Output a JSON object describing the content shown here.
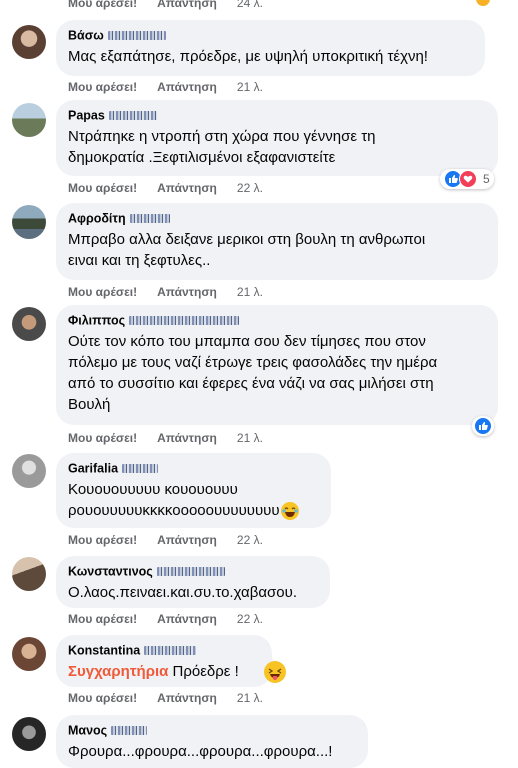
{
  "top_actions": {
    "like": "Μου αρέσει!",
    "reply": "Απάντηση",
    "time": "24 λ."
  },
  "comments": [
    {
      "name": "Βάσω",
      "text": [
        "Μας εξαπάτησε, πρόεδρε, με υψηλή υποκριτική τέχνη!"
      ],
      "like": "Μου αρέσει!",
      "reply": "Απάντηση",
      "time": "21 λ."
    },
    {
      "name": "Papas",
      "text": [
        "Ντράπηκε η ντροπή στη χώρα που γέννησε τη",
        "δημοκρατία .Ξεφτιλισμένοι εξαφανιστείτε"
      ],
      "like": "Μου αρέσει!",
      "reply": "Απάντηση",
      "time": "22 λ.",
      "reaction_count": "5"
    },
    {
      "name": "Αφροδίτη",
      "text": [
        "Μπραβο αλλα δειξανε μερικοι στη βουλη τη ανθρωποι",
        "ειναι και τη ξεφτυλες.."
      ],
      "like": "Μου αρέσει!",
      "reply": "Απάντηση",
      "time": "21 λ."
    },
    {
      "name": "Φιλιππος",
      "text": [
        "Ούτε τον κόπο του μπαμπα σου δεν τίμησες που στον",
        "πόλεμο με τους ναζί έτρωγε τρεις φασολάδες την ημέρα",
        "από το συσσίτιο και έφερες ένα νάζι να σας μιλήσει στη",
        "Βουλή"
      ],
      "like": "Μου αρέσει!",
      "reply": "Απάντηση",
      "time": "21 λ."
    },
    {
      "name": "Garifalia",
      "text": [
        "Κουουουυυυυ κουουουυυ",
        "ρουουυυυυκκκκοοοοουυυυυυυυ"
      ],
      "like": "Μου αρέσει!",
      "reply": "Απάντηση",
      "time": "22 λ."
    },
    {
      "name": "Κωνσταντινος",
      "text": [
        "Ο.λαος.πειναει.και.συ.το.χαβασου."
      ],
      "like": "Μου αρέσει!",
      "reply": "Απάντηση",
      "time": "22 λ."
    },
    {
      "name": "Konstantina",
      "text_accent": "Συγχαρητήρια",
      "text_rest": " Πρόεδρε !",
      "like": "Μου αρέσει!",
      "reply": "Απάντηση",
      "time": "21 λ."
    },
    {
      "name": "Μανος",
      "text": [
        "Φρουρα...φρουρα...φρουρα...φρουρα...!"
      ]
    }
  ],
  "icons": {
    "like_reaction": "thumbs-up-icon",
    "love_reaction": "heart-icon",
    "laugh": "laughing-emoji-icon",
    "tongue": "tongue-emoji-icon"
  },
  "colors": {
    "bubble": "#f0f2f5",
    "secondary": "#65676b",
    "like_blue": "#1877f2",
    "love_red": "#f33e58",
    "accent_orange": "#f05a38"
  }
}
